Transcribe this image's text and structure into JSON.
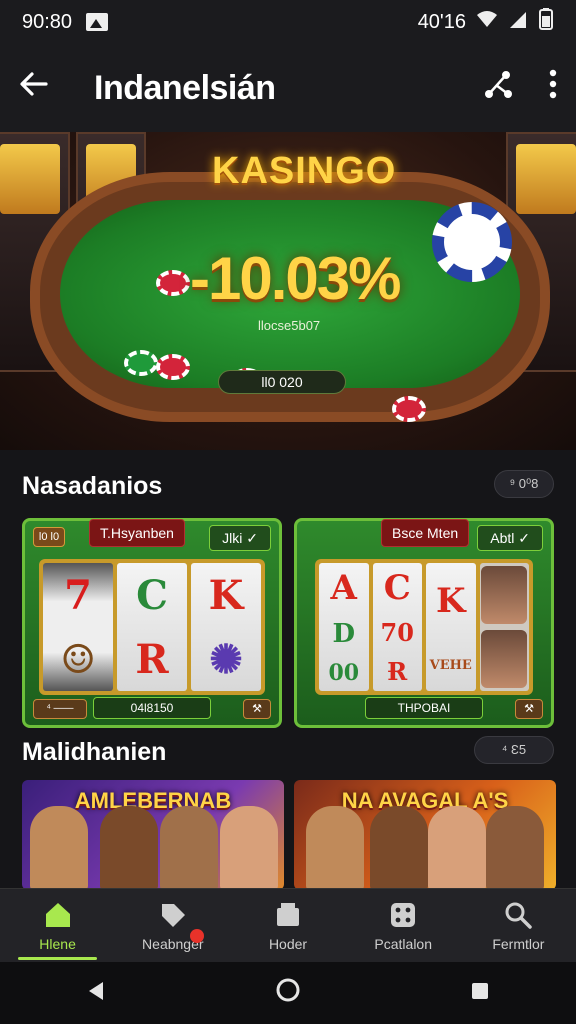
{
  "status_bar": {
    "time": "90:80",
    "right_text": "40'16",
    "icons": [
      "image-icon",
      "wifi-icon",
      "signal-icon",
      "battery-icon"
    ]
  },
  "app_bar": {
    "back_icon": "arrow-left-icon",
    "title": "Indanelsián",
    "share_icon": "share-icon",
    "menu_icon": "more-vertical-icon"
  },
  "hero": {
    "brand": "KASINGO",
    "percent": "-10.03%",
    "sub": "llocse5b07",
    "pill": "ll0 020"
  },
  "section1": {
    "title": "Nasadanios",
    "tag": "⁹ 0⁰8",
    "cards": [
      {
        "corner": "l0 l0",
        "header": "T.Hsyanben",
        "header_right": "Jlki ✓",
        "reels": [
          [
            "7",
            "☺"
          ],
          [
            "C",
            "R"
          ],
          [
            "K",
            "✺"
          ]
        ],
        "footer_left": "⁴ ——",
        "footer": "04l8150",
        "footer_right": "⚒"
      },
      {
        "header": "Bsce Mten",
        "header_right": "Abtl ✓",
        "reels": [
          [
            "A",
            "D",
            "00"
          ],
          [
            "C",
            "70",
            "Ɍ"
          ],
          [
            "K",
            "VEHE"
          ]
        ],
        "footer": "THPOBAI",
        "footer_right": "⚒"
      }
    ]
  },
  "section2": {
    "title": "Malidhanien",
    "tag": "⁴ Ɛ5",
    "banners": [
      {
        "title": "AMLEBERNAB"
      },
      {
        "title": "NA AVAGAL A'S"
      }
    ]
  },
  "bottom_nav": [
    {
      "label": "Hlene",
      "icon": "home-icon",
      "active": true
    },
    {
      "label": "Neabnger",
      "icon": "tag-icon",
      "active": false
    },
    {
      "label": "Hoder",
      "icon": "ticket-icon",
      "active": false
    },
    {
      "label": "Pcatlalon",
      "icon": "dice-icon",
      "active": false
    },
    {
      "label": "Fermtlor",
      "icon": "search-icon",
      "active": false
    }
  ],
  "system_nav": [
    "back-triangle-icon",
    "home-circle-icon",
    "recents-square-icon"
  ],
  "colors": {
    "accent": "#a8e84e",
    "gold": "#ffd447",
    "felt": "#1c7d25",
    "background": "#151518"
  }
}
